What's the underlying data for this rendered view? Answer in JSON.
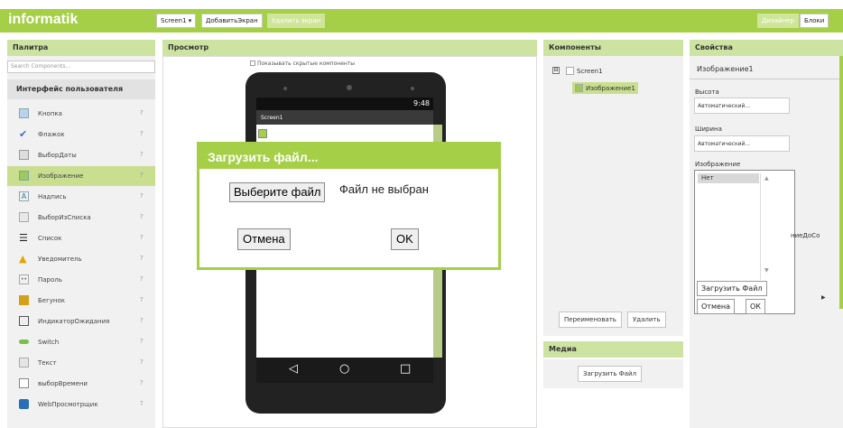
{
  "app": {
    "logo": "informatik"
  },
  "toolbar": {
    "screen_select": "Screen1 ▾",
    "add_screen": "ДобавитьЭкран",
    "remove_screen": "Удалить экран",
    "designer": "Дизайнер",
    "blocks": "Блоки"
  },
  "palette": {
    "header": "Палитра",
    "search_placeholder": "Search Components...",
    "category": "Интерфейс пользователя",
    "help_glyph": "?",
    "items": [
      {
        "label": "Кнопка",
        "icon": "button-icon"
      },
      {
        "label": "Флажок",
        "icon": "checkbox-icon"
      },
      {
        "label": "ВыборДаты",
        "icon": "datepicker-icon"
      },
      {
        "label": "Изображение",
        "icon": "image-icon"
      },
      {
        "label": "Надпись",
        "icon": "label-icon"
      },
      {
        "label": "ВыборИзСписка",
        "icon": "listpicker-icon"
      },
      {
        "label": "Список",
        "icon": "listview-icon"
      },
      {
        "label": "Уведомитель",
        "icon": "notifier-icon"
      },
      {
        "label": "Пароль",
        "icon": "password-icon"
      },
      {
        "label": "Бегунок",
        "icon": "slider-icon"
      },
      {
        "label": "ИндикаторОжидания",
        "icon": "spinner-icon"
      },
      {
        "label": "Switch",
        "icon": "switch-icon"
      },
      {
        "label": "Текст",
        "icon": "textbox-icon"
      },
      {
        "label": "выборВремени",
        "icon": "timepicker-icon"
      },
      {
        "label": "WebПросмотрщик",
        "icon": "webviewer-icon"
      }
    ]
  },
  "viewer": {
    "header": "Просмотр",
    "show_hidden": "Показывать скрытые компоненты",
    "phone": {
      "time": "9:48",
      "screen_title": "Screen1"
    }
  },
  "components": {
    "header": "Компоненты",
    "tree_toggle": "⊟",
    "screen": "Screen1",
    "child": "Изображение1",
    "rename": "Переименовать",
    "delete": "Удалить"
  },
  "media": {
    "header": "Медиа",
    "upload": "Загрузить Файл"
  },
  "properties": {
    "header": "Свойства",
    "component": "Изображение1",
    "height_label": "Высота",
    "height_value": "Автоматический...",
    "width_label": "Ширина",
    "width_value": "Автоматический...",
    "picture_label": "Изображение",
    "picture_option": "Нет",
    "upload": "Загрузить Файл",
    "cancel": "Отмена",
    "ok": "ОК",
    "cut_label": "ниеДоСо"
  },
  "dialog": {
    "title": "Загрузить файл...",
    "choose": "Выберите файл",
    "none_chosen": "Файл не выбран",
    "cancel": "Отмена",
    "ok": "OK"
  },
  "colors": {
    "accent": "#a5cf47",
    "header": "#cde3a1",
    "selected": "#c9de8e"
  }
}
